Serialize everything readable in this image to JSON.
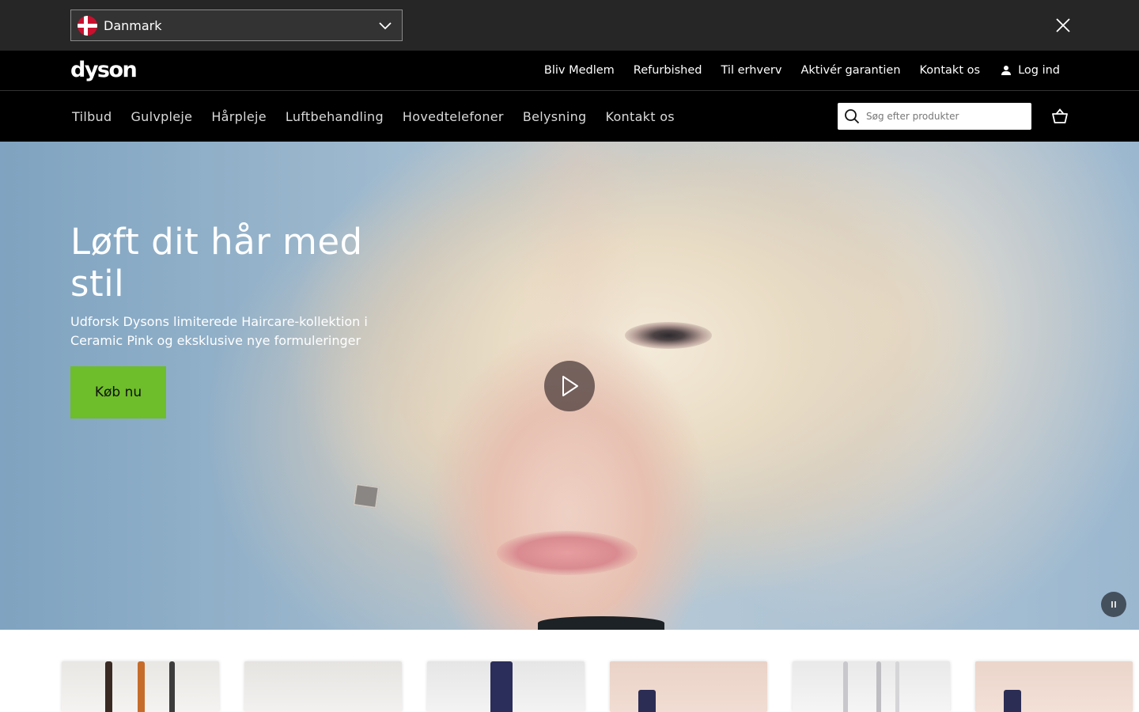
{
  "country_bar": {
    "selected_country": "Danmark"
  },
  "top_nav": {
    "logo": "dyson",
    "links": [
      "Bliv Medlem",
      "Refurbished",
      "Til erhverv",
      "Aktivér garantien",
      "Kontakt os"
    ],
    "login_label": "Log ind"
  },
  "category_nav": {
    "items": [
      "Tilbud",
      "Gulvpleje",
      "Hårpleje",
      "Luftbehandling",
      "Hovedtelefoner",
      "Belysning",
      "Kontakt os"
    ],
    "search_placeholder": "Søg efter produkter"
  },
  "hero": {
    "title": "Løft dit hår med stil",
    "subtitle": "Udforsk Dysons limiterede Haircare-kollektion i Ceramic Pink og eksklusive nye formuleringer",
    "cta_label": "Køb nu"
  },
  "colors": {
    "cta_green": "#6ebd2a",
    "nav_bg": "#000000",
    "country_bar_bg": "#262626"
  }
}
